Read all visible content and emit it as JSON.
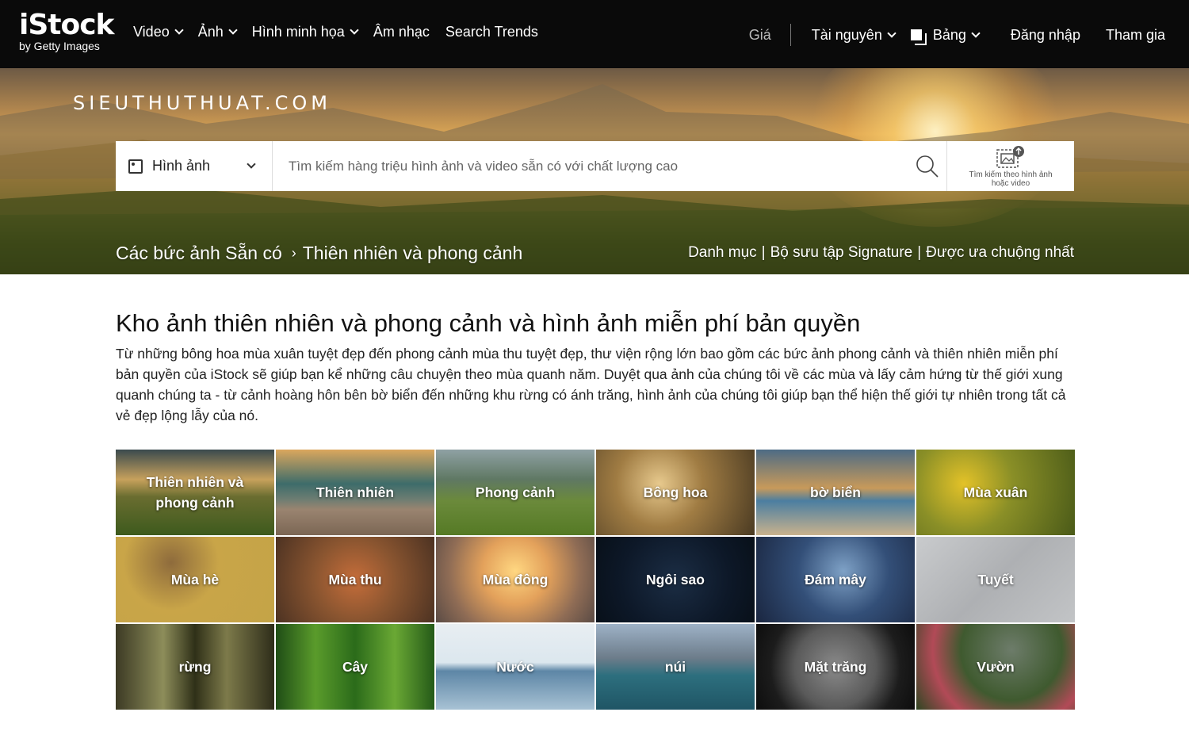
{
  "nav": {
    "logo_main": "iStock",
    "logo_sub": "by Getty Images",
    "left_items": [
      {
        "label": "Video",
        "dropdown": true
      },
      {
        "label": "Ảnh",
        "dropdown": true
      },
      {
        "label": "Hình minh họa",
        "dropdown": true
      },
      {
        "label": "Âm nhạc",
        "dropdown": false
      },
      {
        "label": "Search Trends",
        "dropdown": false
      }
    ],
    "price": "Giá",
    "resources": "Tài nguyên",
    "board": "Bảng",
    "login": "Đăng nhập",
    "join": "Tham gia"
  },
  "hero": {
    "watermark": "SIEUTHUTHUAT.COM",
    "search_type": "Hình ảnh",
    "search_placeholder": "Tìm kiếm hàng triệu hình ảnh và video sẵn có với chất lượng cao",
    "visual_search": "Tìm kiếm theo hình ảnh hoặc video",
    "breadcrumb": [
      "Các bức ảnh Sẵn có",
      "Thiên nhiên và phong cảnh"
    ],
    "breadcrumb_sep": "›",
    "links": [
      "Danh mục",
      "Bộ sưu tập Signature",
      "Được ưa chuộng nhất"
    ]
  },
  "content": {
    "title": "Kho ảnh thiên nhiên và phong cảnh và hình ảnh miễn phí bản quyền",
    "description": "Từ những bông hoa mùa xuân tuyệt đẹp đến phong cảnh mùa thu tuyệt đẹp, thư viện rộng lớn bao gồm các bức ảnh phong cảnh và thiên nhiên miễn phí bản quyền của iStock sẽ giúp bạn kể những câu chuyện theo mùa quanh năm. Duyệt qua ảnh của chúng tôi về các mùa và lấy cảm hứng từ thế giới xung quanh chúng ta - từ cảnh hoàng hôn bên bờ biển đến những khu rừng có ánh trăng, hình ảnh của chúng tôi giúp bạn thể hiện thế giới tự nhiên trong tất cả vẻ đẹp lộng lẫy của nó."
  },
  "categories": [
    "Thiên nhiên và phong cảnh",
    "Thiên nhiên",
    "Phong cảnh",
    "Bông hoa",
    "bờ biển",
    "Mùa xuân",
    "Mùa hè",
    "Mùa thu",
    "Mùa đông",
    "Ngôi sao",
    "Đám mây",
    "Tuyết",
    "rừng",
    "Cây",
    "Nước",
    "núi",
    "Mặt trăng",
    "Vườn"
  ]
}
